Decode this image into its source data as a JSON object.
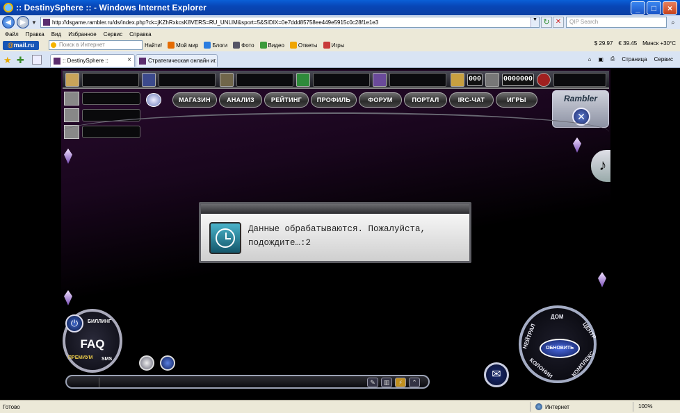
{
  "window": {
    "title": ":: DestinySphere :: - Windows Internet Explorer",
    "min_label": "_",
    "max_label": "□",
    "close_label": "×"
  },
  "address": {
    "url": "http://dsgame.rambler.ru/ds/index.php?ck=jKZhRxkcsK8VERS=RU_UNLIM&sport=5&SIDIX=0e7ddd85758ee449e5915c0c28f1e1e3",
    "search_placeholder": "QIP Search"
  },
  "menu": {
    "items": [
      "Файл",
      "Правка",
      "Вид",
      "Избранное",
      "Сервис",
      "Справка"
    ]
  },
  "mailbar": {
    "logo_at": "@",
    "logo_text": "mail.ru",
    "search_placeholder": "Поиск в Интернет",
    "find_label": "Найти!",
    "items": [
      "Мой мир",
      "Блоги",
      "Фото",
      "Видео",
      "Ответы",
      "Игры"
    ],
    "usd": "29.97",
    "eur": "39.45",
    "weather": "Минск +30°C"
  },
  "tabs": {
    "items": [
      {
        "label": ":: DestinySphere ::"
      },
      {
        "label": "Стратегическая онлайн иг..."
      }
    ],
    "page_label": "Страница",
    "service_label": "Сервис"
  },
  "game": {
    "counter_a": "000",
    "counter_b": "0000000",
    "nav": [
      "МАГАЗИН",
      "АНАЛИЗ",
      "РЕЙТИНГ",
      "ПРОФИЛЬ",
      "ФОРУМ",
      "ПОРТАЛ",
      "IRC-ЧАТ",
      "ИГРЫ"
    ],
    "rambler": "Rambler",
    "dialog_message": "Данные обрабатываются. Пожалуйста, подождите…:2",
    "faq": "FAQ",
    "emblem_labels": [
      "БИЛЛИНГ",
      "ПРЕМИУМ",
      "SMS"
    ],
    "wheel_center": "ОБНОВИТЬ",
    "wheel_labels": [
      "ДОМ",
      "ЦЕНТР",
      "КОМПЛЕКС",
      "КОЛОНИИ",
      "НЕЙТРАЛ"
    ]
  },
  "status": {
    "text": "Готово",
    "zone": "Интернет",
    "zoom": "100%"
  },
  "colors": {
    "title_bar": "#0a4fc4",
    "chrome": "#ece9d8",
    "game_bg": "#000000",
    "dialog_bg": "#dcdcdc",
    "wheel_accent": "#4a6ae0"
  },
  "icons": [
    "ie-icon",
    "back-icon",
    "forward-icon",
    "refresh-icon",
    "stop-icon",
    "favorites-star-icon",
    "clock-icon",
    "power-icon",
    "mail-icon",
    "music-icon",
    "lock-icon"
  ]
}
